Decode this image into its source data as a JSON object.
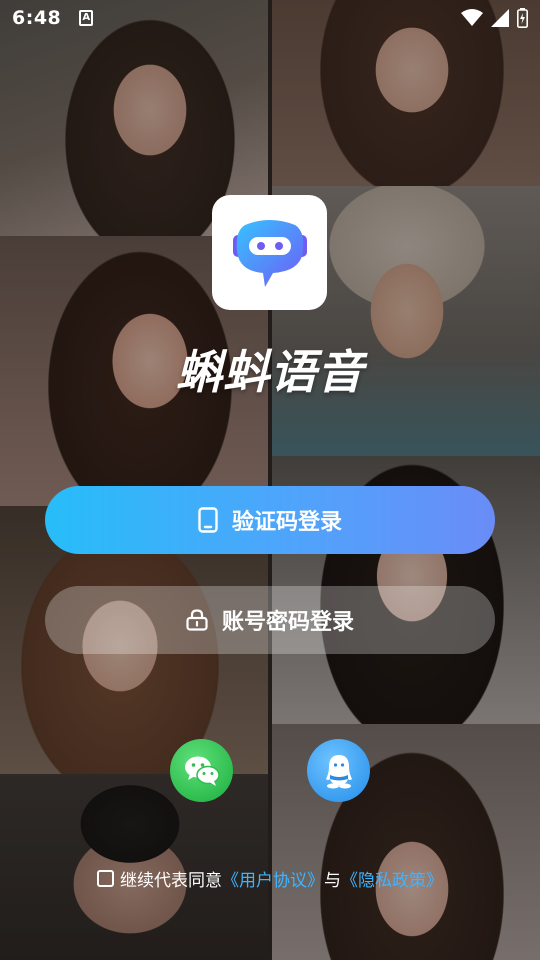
{
  "status_bar": {
    "time": "6:48",
    "notification_icon": "a-icon",
    "notification_letter": "A",
    "icons": [
      "wifi-icon",
      "signal-icon",
      "battery-icon"
    ]
  },
  "app": {
    "logo_icon": "robot-chat-bubble-icon",
    "name": "蝌蚪语音"
  },
  "login": {
    "code_button": {
      "label": "验证码登录",
      "icon": "phone-icon"
    },
    "password_button": {
      "label": "账号密码登录",
      "icon": "lock-icon"
    }
  },
  "social": {
    "wechat_icon": "wechat-icon",
    "qq_icon": "qq-icon"
  },
  "agreement": {
    "prefix": "继续代表同意",
    "user_agreement": "《用户协议》",
    "joiner": "与",
    "privacy_policy": "《隐私政策》"
  },
  "colors": {
    "primary_gradient_start": "#27bdf9",
    "primary_gradient_end": "#6a8cf7",
    "link": "#3fb4ff",
    "wechat": "#2fbd4f",
    "qq": "#3a9df0"
  }
}
